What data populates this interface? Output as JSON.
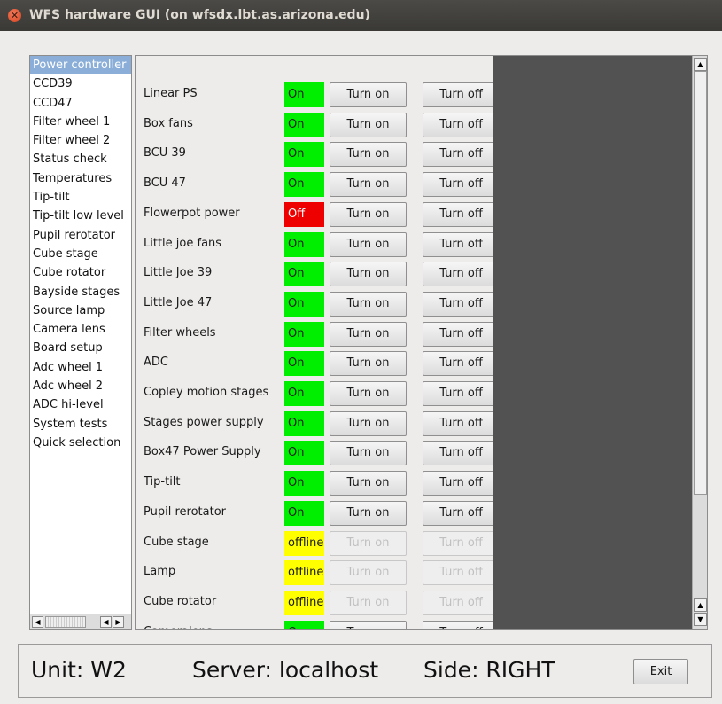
{
  "window": {
    "title": "WFS hardware GUI (on wfsdx.lbt.as.arizona.edu)"
  },
  "colors": {
    "on": "#00ee00",
    "off": "#ee0000",
    "offline": "#ffff00",
    "panel_dark": "#525252"
  },
  "sidebar": {
    "selected_index": 0,
    "items": [
      "Power controller",
      "CCD39",
      "CCD47",
      "Filter wheel 1",
      "Filter wheel 2",
      "Status check",
      "Temperatures",
      "Tip-tilt",
      "Tip-tilt low level",
      "Pupil rerotator",
      "Cube stage",
      "Cube rotator",
      "Bayside stages",
      "Source lamp",
      "Camera lens",
      "Board setup",
      "Adc wheel 1",
      "Adc wheel 2",
      "ADC hi-level",
      "System tests",
      "Quick selection"
    ]
  },
  "power": {
    "turn_on_label": "Turn on",
    "turn_off_label": "Turn off",
    "rows": [
      {
        "label": "Linear PS",
        "status": "On",
        "state": "on"
      },
      {
        "label": "Box fans",
        "status": "On",
        "state": "on"
      },
      {
        "label": "BCU 39",
        "status": "On",
        "state": "on"
      },
      {
        "label": "BCU 47",
        "status": "On",
        "state": "on"
      },
      {
        "label": "Flowerpot power",
        "status": "Off",
        "state": "off"
      },
      {
        "label": "Little joe fans",
        "status": "On",
        "state": "on"
      },
      {
        "label": "Little Joe 39",
        "status": "On",
        "state": "on"
      },
      {
        "label": "Little Joe 47",
        "status": "On",
        "state": "on"
      },
      {
        "label": "Filter wheels",
        "status": "On",
        "state": "on"
      },
      {
        "label": "ADC",
        "status": "On",
        "state": "on"
      },
      {
        "label": "Copley motion stages",
        "status": "On",
        "state": "on"
      },
      {
        "label": "Stages power supply",
        "status": "On",
        "state": "on"
      },
      {
        "label": "Box47 Power Supply",
        "status": "On",
        "state": "on"
      },
      {
        "label": "Tip-tilt",
        "status": "On",
        "state": "on"
      },
      {
        "label": "Pupil rerotator",
        "status": "On",
        "state": "on"
      },
      {
        "label": "Cube stage",
        "status": "offline",
        "state": "offline"
      },
      {
        "label": "Lamp",
        "status": "offline",
        "state": "offline"
      },
      {
        "label": "Cube rotator",
        "status": "offline",
        "state": "offline"
      },
      {
        "label": "Cameralens",
        "status": "On",
        "state": "on"
      }
    ]
  },
  "footer": {
    "unit": "Unit: W2",
    "server": "Server: localhost",
    "side": "Side: RIGHT",
    "exit_label": "Exit"
  }
}
